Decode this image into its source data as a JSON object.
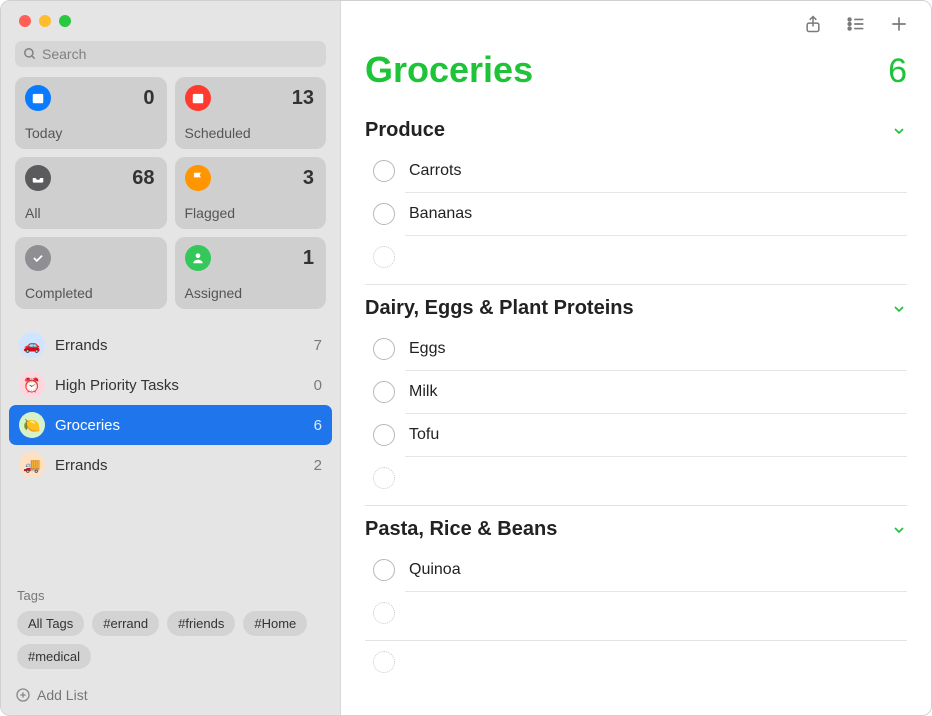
{
  "search": {
    "placeholder": "Search"
  },
  "smart": {
    "today": {
      "label": "Today",
      "count": 0
    },
    "scheduled": {
      "label": "Scheduled",
      "count": 13
    },
    "all": {
      "label": "All",
      "count": 68
    },
    "flagged": {
      "label": "Flagged",
      "count": 3
    },
    "completed": {
      "label": "Completed"
    },
    "assigned": {
      "label": "Assigned",
      "count": 1
    }
  },
  "lists": [
    {
      "name": "Errands",
      "count": 7
    },
    {
      "name": "High Priority Tasks",
      "count": 0
    },
    {
      "name": "Groceries",
      "count": 6
    },
    {
      "name": "Errands",
      "count": 2
    }
  ],
  "tags": {
    "header": "Tags",
    "items": [
      "All Tags",
      "#errand",
      "#friends",
      "#Home",
      "#medical"
    ]
  },
  "addList": {
    "label": "Add List"
  },
  "main": {
    "title": "Groceries",
    "total": 6,
    "sections": [
      {
        "title": "Produce",
        "items": [
          "Carrots",
          "Bananas"
        ]
      },
      {
        "title": "Dairy, Eggs & Plant Proteins",
        "items": [
          "Eggs",
          "Milk",
          "Tofu"
        ]
      },
      {
        "title": "Pasta, Rice & Beans",
        "items": [
          "Quinoa"
        ]
      }
    ]
  }
}
